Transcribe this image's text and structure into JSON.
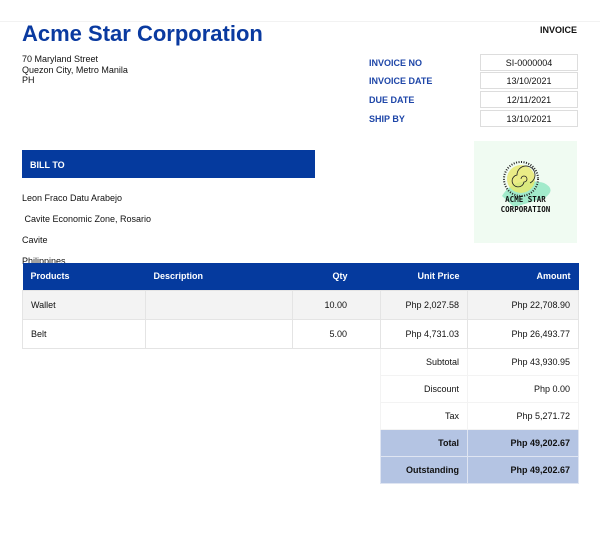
{
  "company": {
    "name": "Acme Star Corporation",
    "address": [
      "70 Maryland Street",
      "Quezon City, Metro Manila",
      "PH"
    ]
  },
  "doc_type": "INVOICE",
  "meta": [
    {
      "label": "INVOICE NO",
      "value": "SI-0000004"
    },
    {
      "label": "INVOICE DATE",
      "value": "13/10/2021"
    },
    {
      "label": "DUE DATE",
      "value": "12/11/2021"
    },
    {
      "label": "SHIP BY",
      "value": "13/10/2021"
    }
  ],
  "bill_to": {
    "title": "BILL TO",
    "lines": [
      "Leon Fraco Datu Arabejo",
      " Cavite Economic Zone, Rosario",
      "Cavite",
      "Philippines"
    ]
  },
  "logo": {
    "text": [
      "ACME STAR",
      "CORPORATION"
    ]
  },
  "table": {
    "headers": [
      "Products",
      "Description",
      "Qty",
      "Unit Price",
      "Amount"
    ],
    "rows": [
      [
        "Wallet",
        "",
        "10.00",
        "Php 2,027.58",
        "Php 22,708.90"
      ],
      [
        "Belt",
        "",
        "5.00",
        "Php 4,731.03",
        "Php 26,493.77"
      ]
    ]
  },
  "summary": [
    {
      "label": "Subtotal",
      "value": "Php 43,930.95"
    },
    {
      "label": "Discount",
      "value": "Php 0.00"
    },
    {
      "label": "Tax",
      "value": "Php 5,271.72"
    },
    {
      "label": "Total",
      "value": "Php 49,202.67"
    },
    {
      "label": "Outstanding",
      "value": "Php 49,202.67"
    }
  ],
  "colors": {
    "brand": "#053a9e",
    "highlight": "#b4c4e3"
  }
}
